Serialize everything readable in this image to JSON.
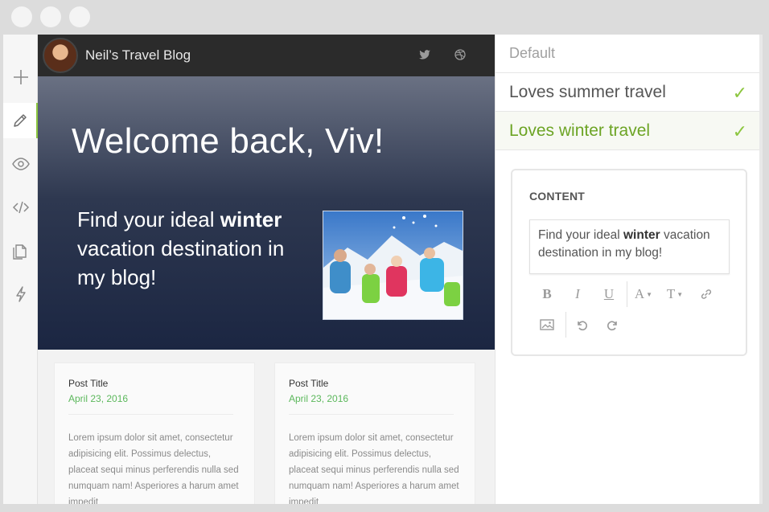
{
  "window": {
    "controls": [
      "close",
      "minimize",
      "maximize"
    ]
  },
  "rail": {
    "items": [
      {
        "icon": "plus-icon",
        "active": false
      },
      {
        "icon": "pencil-icon",
        "active": true
      },
      {
        "icon": "eye-icon",
        "active": false
      },
      {
        "icon": "code-icon",
        "active": false
      },
      {
        "icon": "pages-icon",
        "active": false
      },
      {
        "icon": "bolt-icon",
        "active": false
      }
    ]
  },
  "blog": {
    "site_title": "Neil’s Travel Blog",
    "header_icons": [
      "twitter-icon",
      "dribbble-icon"
    ],
    "hero": {
      "headline": "Welcome back, Viv!",
      "text_before": "Find your ideal ",
      "text_bold": "winter",
      "text_after": " vacation destination in my blog!"
    },
    "posts": [
      {
        "title": "Post Title",
        "date": "April 23, 2016",
        "excerpt": "Lorem ipsum dolor sit amet, consectetur adipisicing elit. Possimus delectus, placeat sequi minus perferendis nulla sed numquam nam! Asperiores a harum amet impedit"
      },
      {
        "title": "Post Title",
        "date": "April 23, 2016",
        "excerpt": "Lorem ipsum dolor sit amet, consectetur adipisicing elit. Possimus delectus, placeat sequi minus perferendis nulla sed numquam nam! Asperiores a harum amet impedit"
      }
    ]
  },
  "panel": {
    "segments": [
      {
        "label": "Default",
        "checked": false
      },
      {
        "label": "Loves summer travel",
        "checked": true
      },
      {
        "label": "Loves winter travel",
        "checked": true,
        "active": true
      }
    ],
    "check_glyph": "✓",
    "editor": {
      "heading": "CONTENT",
      "text_before": "Find your ideal ",
      "text_bold": "winter",
      "text_after": " vacation destination in my blog!",
      "toolbar": {
        "bold": "B",
        "italic": "I",
        "underline": "U",
        "font_color": "A",
        "font_size": "T",
        "link": "link-icon",
        "image": "image-icon",
        "undo": "undo-icon",
        "redo": "redo-icon"
      }
    }
  },
  "colors": {
    "accent": "#8cc63f",
    "active_text": "#6ca424",
    "date": "#5cb85c",
    "header_bg": "#2b2b2b"
  }
}
